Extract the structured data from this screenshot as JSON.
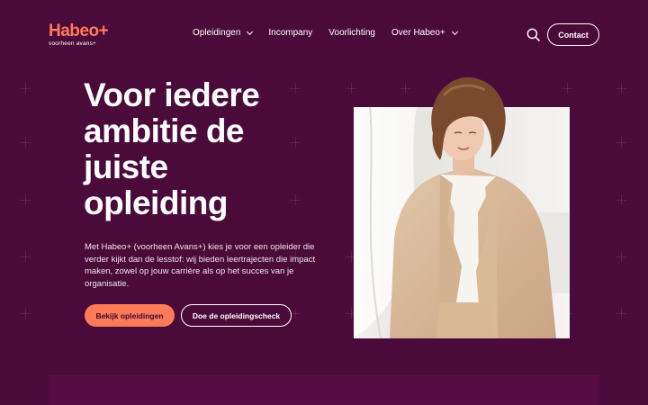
{
  "logo": {
    "name": "Habeo+",
    "tagline": "voorheen avans+"
  },
  "nav": {
    "items": [
      {
        "label": "Opleidingen",
        "has_dropdown": true
      },
      {
        "label": "Incompany",
        "has_dropdown": false
      },
      {
        "label": "Voorlichting",
        "has_dropdown": false
      },
      {
        "label": "Over Habeo+",
        "has_dropdown": true
      }
    ],
    "search_icon": "search-icon",
    "contact_label": "Contact"
  },
  "hero": {
    "title": "Voor iedere ambitie de juiste opleiding",
    "text": "Met Habeo+ (voorheen Avans+) kies je voor een opleider die verder kijkt dan de lesstof: wij bieden leertrajecten die impact maken, zowel op jouw carrière als op het succes van je organisatie.",
    "primary_button": "Bekijk opleidingen",
    "secondary_button": "Doe de opleidingscheck"
  },
  "colors": {
    "background": "#4a0b3a",
    "accent": "#ff7a59",
    "text": "#ffffff"
  }
}
